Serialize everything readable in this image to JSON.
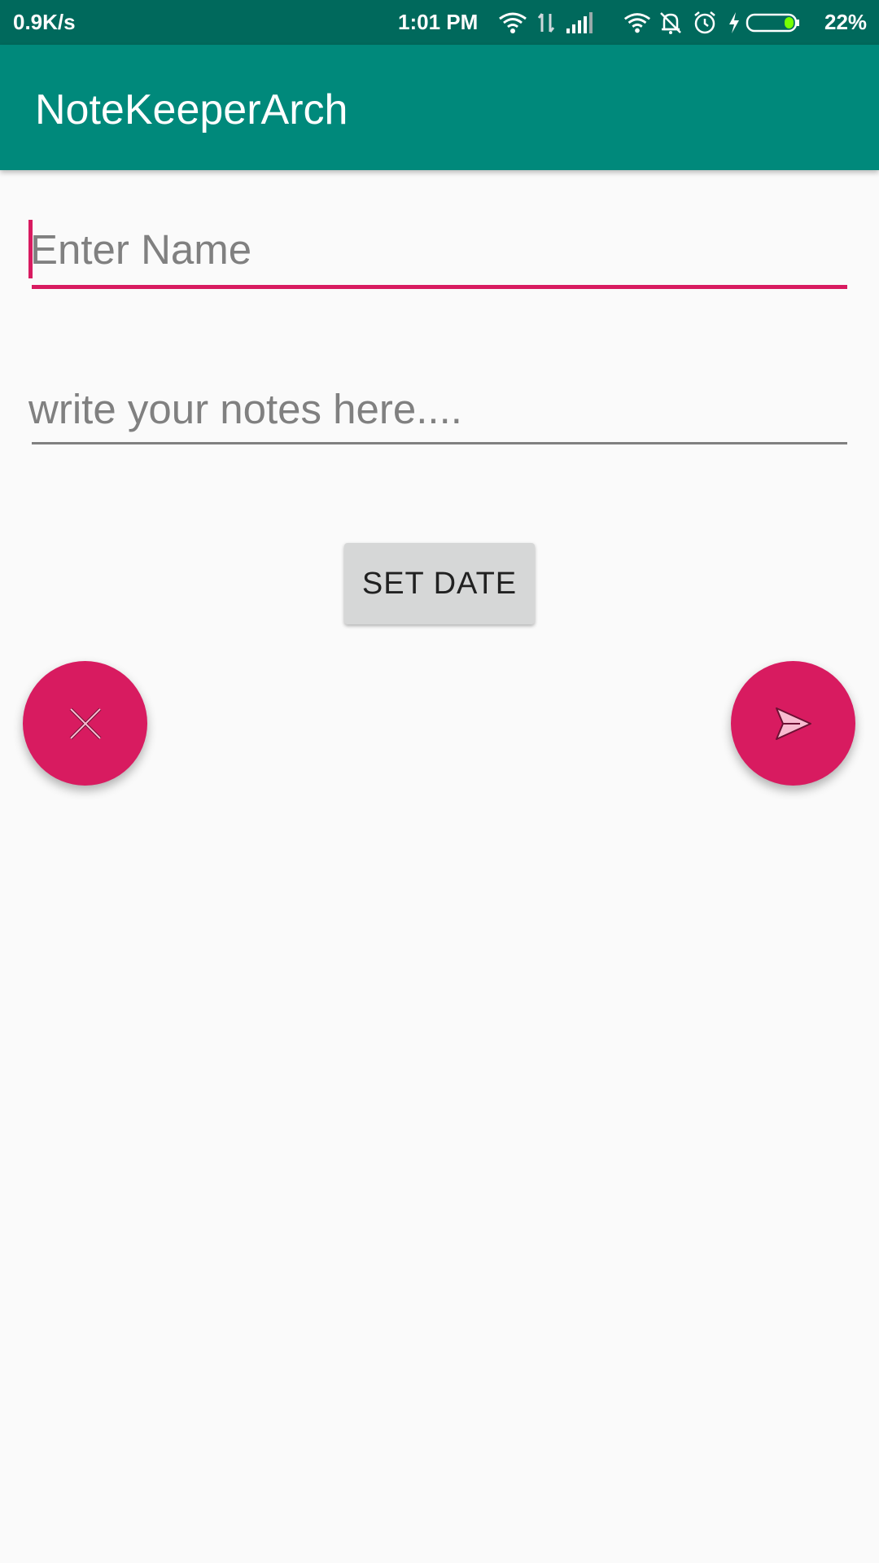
{
  "status_bar": {
    "net_speed": "0.9K/s",
    "time": "1:01 PM",
    "battery_percent": "22%",
    "icons": [
      "wifi-icon",
      "data-arrows-icon",
      "signal-icon",
      "wifi-icon",
      "bell-off-icon",
      "alarm-icon",
      "charging-icon",
      "battery-icon"
    ]
  },
  "app_bar": {
    "title": "NoteKeeperArch"
  },
  "form": {
    "name_placeholder": "Enter Name",
    "notes_placeholder": "write your notes here....",
    "set_date_label": "SET DATE"
  },
  "fabs": {
    "cancel_icon": "close-icon",
    "send_icon": "send-icon"
  },
  "colors": {
    "primary": "#00897b",
    "primary_dark": "#00695c",
    "accent": "#d81b60",
    "background": "#fafafa"
  }
}
